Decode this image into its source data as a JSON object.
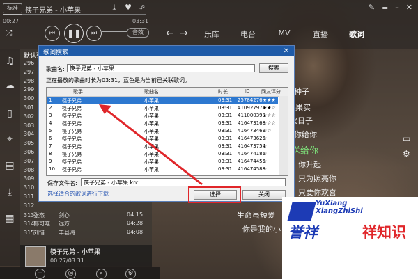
{
  "player": {
    "mode": "标准",
    "track": "筷子兄弟 - 小苹果",
    "elapsed": "00:27",
    "duration": "03:31",
    "progress": 0.13,
    "effect": "音效"
  },
  "nav": {
    "items": [
      "乐库",
      "电台",
      "MV",
      "直播",
      "歌词"
    ],
    "active": "歌词"
  },
  "playlist": {
    "header": "默认列表",
    "rows": [
      {
        "n": "296",
        "time": ""
      },
      {
        "n": "297",
        "time": ""
      },
      {
        "n": "298",
        "time": ""
      },
      {
        "n": "299",
        "time": ""
      },
      {
        "n": "300",
        "time": ""
      },
      {
        "n": "301",
        "time": ""
      },
      {
        "n": "302",
        "time": ""
      },
      {
        "n": "303",
        "time": ""
      },
      {
        "n": "304",
        "time": ""
      },
      {
        "n": "305",
        "time": ""
      },
      {
        "n": "306",
        "time": ""
      },
      {
        "n": "307",
        "time": ""
      },
      {
        "n": "308",
        "time": ""
      },
      {
        "n": "309",
        "time": ""
      },
      {
        "n": "310",
        "time": ""
      },
      {
        "n": "311",
        "time": ""
      },
      {
        "n": "312",
        "time": ""
      },
      {
        "n": "313",
        "singer": "张杰",
        "song": "剑心",
        "time": "04:15"
      },
      {
        "n": "314",
        "singer": "郁可唯",
        "song": "远方",
        "time": "04:28"
      },
      {
        "n": "315",
        "singer": "刘惜",
        "song": "丰县海",
        "time": "04:08"
      }
    ],
    "now_playing": {
      "title": "筷子兄弟 - 小苹果",
      "time": "00:27/03:31"
    }
  },
  "lyrics": {
    "lines": [
      "种子",
      "果实",
      "火日子",
      "你给你",
      "送给你",
      "你升起",
      "只为照亮你",
      "只要你欢喜",
      "生命虽短爱",
      "你是我的小"
    ],
    "highlight": "送给你"
  },
  "dialog": {
    "title": "歌词搜索",
    "name_label": "歌曲名:",
    "name_value": "筷子兄弟 - 小苹果",
    "search_button": "搜索",
    "info": "正在播放的歌曲时长为03:31，蓝色是为当前已关联歌词。",
    "columns": [
      "歌手",
      "歌曲名",
      "时长",
      "ID",
      "网友评分"
    ],
    "rows": [
      {
        "n": "1",
        "singer": "筷子兄弟",
        "song": "小苹果",
        "dur": "03:31",
        "id": "25784276",
        "rating": "★★★",
        "selected": true
      },
      {
        "n": "2",
        "singer": "筷子兄弟",
        "song": "小苹果",
        "dur": "03:31",
        "id": "410927974",
        "rating": "★★☆"
      },
      {
        "n": "3",
        "singer": "筷子兄弟",
        "song": "小苹果",
        "dur": "03:31",
        "id": "411000398",
        "rating": "★☆☆"
      },
      {
        "n": "4",
        "singer": "筷子兄弟",
        "song": "小苹果",
        "dur": "03:31",
        "id": "416473168",
        "rating": "☆☆☆"
      },
      {
        "n": "5",
        "singer": "筷子兄弟",
        "song": "小苹果",
        "dur": "03:31",
        "id": "416473469",
        "rating": "☆☆"
      },
      {
        "n": "6",
        "singer": "筷子兄弟",
        "song": "小苹果",
        "dur": "03:31",
        "id": "416473625",
        "rating": "☆"
      },
      {
        "n": "7",
        "singer": "筷子兄弟",
        "song": "小苹果",
        "dur": "03:31",
        "id": "416473754",
        "rating": "☆"
      },
      {
        "n": "8",
        "singer": "筷子兄弟",
        "song": "小苹果",
        "dur": "03:31",
        "id": "416474185",
        "rating": "☆"
      },
      {
        "n": "9",
        "singer": "筷子兄弟",
        "song": "小苹果",
        "dur": "03:31",
        "id": "416474455",
        "rating": "☆"
      },
      {
        "n": "10",
        "singer": "筷子兄弟",
        "song": "小苹果",
        "dur": "03:31",
        "id": "416474588",
        "rating": "☆"
      }
    ],
    "save_label": "保存文件名:",
    "save_value": "筷子兄弟 - 小苹果.krc",
    "hint_link": "选择适合的歌词进行下载",
    "select_button": "选择",
    "close_button": "关闭"
  },
  "watermark": {
    "en1": "YuXiang",
    "en2": "XiangZhiShi",
    "cn1": "誉祥",
    "cn2": "祥知识"
  },
  "colors": {
    "selection": "#2d78d0",
    "dialog_title": "#1f5ba8",
    "highlight_box": "#e0262a",
    "lyric_highlight": "#7ee07a"
  }
}
